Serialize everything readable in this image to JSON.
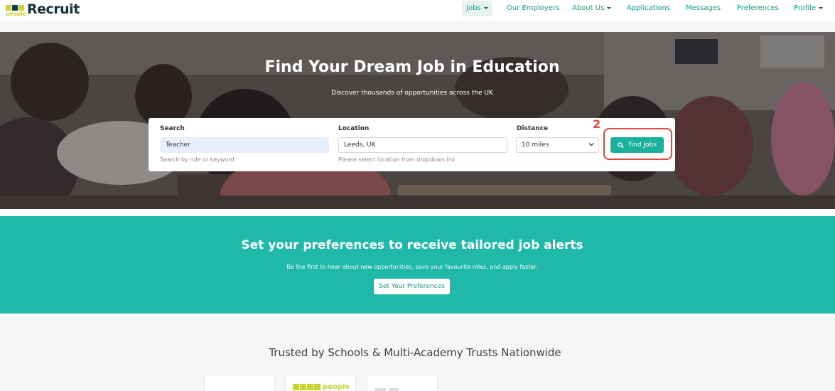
{
  "brand": {
    "logo_people": "people",
    "logo_text": "Recruit"
  },
  "nav": {
    "items": [
      {
        "label": "Jobs",
        "dropdown": true,
        "active": true
      },
      {
        "label": "Our Employers",
        "dropdown": false
      },
      {
        "label": "About Us",
        "dropdown": true
      },
      {
        "label": "Applications",
        "dropdown": false
      },
      {
        "label": "Messages",
        "dropdown": false
      },
      {
        "label": "Preferences",
        "dropdown": false
      },
      {
        "label": "Profile",
        "dropdown": true
      }
    ]
  },
  "hero": {
    "title": "Find Your Dream Job in Education",
    "subtitle": "Discover thousands of opportunities across the UK"
  },
  "search": {
    "search_label": "Search",
    "search_value": "Teacher",
    "search_help": "Search by role or keyword",
    "location_label": "Location",
    "location_value": "Leeds, UK",
    "location_help": "Please select location from dropdown list",
    "distance_label": "Distance",
    "distance_value": "10 miles",
    "find_button": "Find Jobs"
  },
  "annotation": {
    "step_number": "2",
    "color": "#d84a44"
  },
  "preferences_band": {
    "title": "Set your preferences to receive tailored job alerts",
    "subtitle": "Be the first to hear about new opportunities, save your favourite roles, and apply faster.",
    "button": "Set Your Preferences"
  },
  "trust": {
    "title": "Trusted by Schools & Multi-Academy Trusts Nationwide",
    "logo_people": "people"
  },
  "colors": {
    "accent": "#1ab19c",
    "band": "#20b9a9",
    "nav_text": "#1a9c8e"
  }
}
